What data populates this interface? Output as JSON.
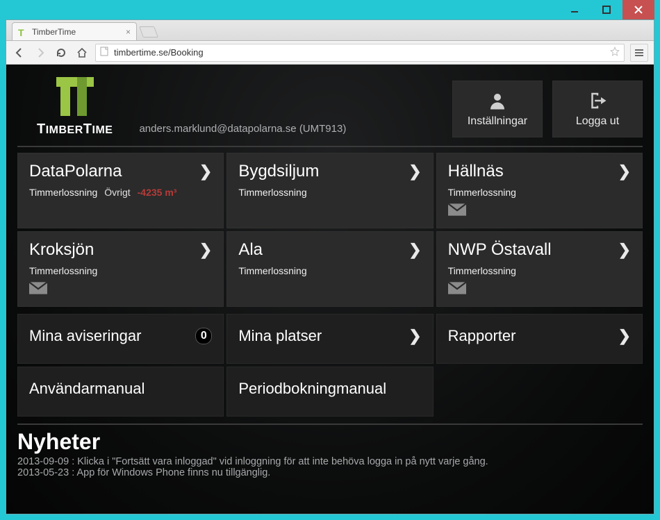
{
  "window": {
    "tab_title": "TimberTime",
    "url": "timbertime.se/Booking"
  },
  "brand": "TimberTime",
  "user_line": "anders.marklund@datapolarna.se (UMT913)",
  "header_buttons": {
    "settings": "Inställningar",
    "logout": "Logga ut"
  },
  "sites": [
    {
      "name": "DataPolarna",
      "sub": "Timmerlossning",
      "extra": "Övrigt",
      "neg": "-4235 m³",
      "mail": false
    },
    {
      "name": "Bygdsiljum",
      "sub": "Timmerlossning",
      "extra": "",
      "neg": "",
      "mail": false
    },
    {
      "name": "Hällnäs",
      "sub": "Timmerlossning",
      "extra": "",
      "neg": "",
      "mail": true
    },
    {
      "name": "Kroksjön",
      "sub": "Timmerlossning",
      "extra": "",
      "neg": "",
      "mail": true
    },
    {
      "name": "Ala",
      "sub": "Timmerlossning",
      "extra": "",
      "neg": "",
      "mail": false
    },
    {
      "name": "NWP Östavall",
      "sub": "Timmerlossning",
      "extra": "",
      "neg": "",
      "mail": true
    }
  ],
  "menu": {
    "notifications_label": "Mina aviseringar",
    "notifications_count": "0",
    "places": "Mina platser",
    "reports": "Rapporter",
    "manual": "Användarmanual",
    "period_manual": "Periodbokningmanual"
  },
  "news": {
    "heading": "Nyheter",
    "items": [
      "2013-09-09 : Klicka i \"Fortsätt vara inloggad\" vid inloggning för att inte behöva logga in på nytt varje gång.",
      "2013-05-23 : App för Windows Phone finns nu tillgänglig."
    ]
  }
}
